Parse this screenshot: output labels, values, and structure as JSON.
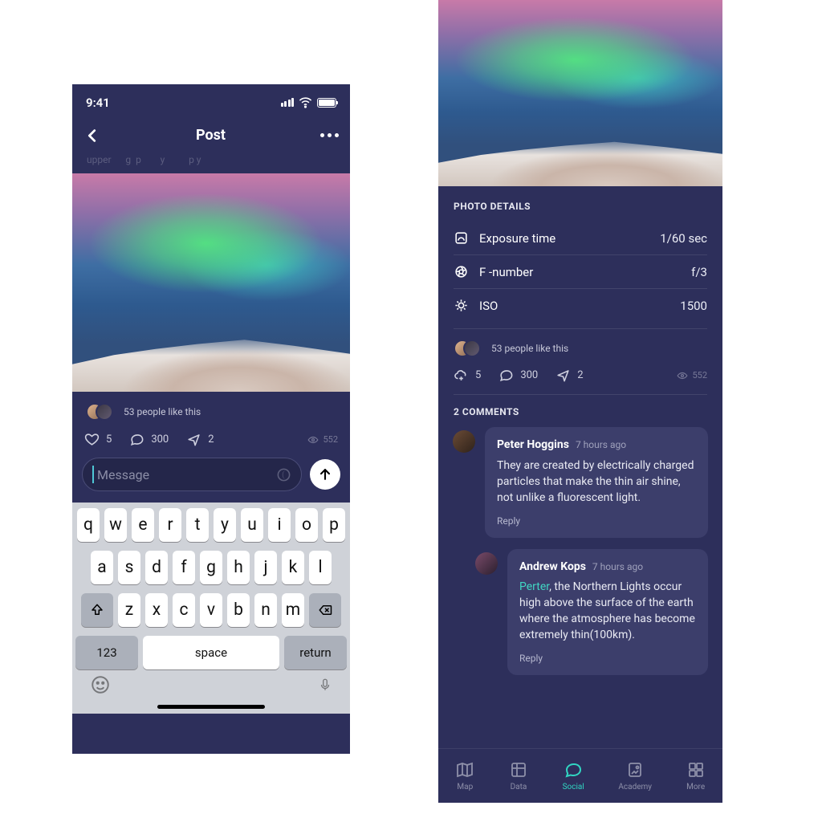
{
  "status": {
    "time": "9:41"
  },
  "header": {
    "title": "Post"
  },
  "likes": {
    "text": "53 people like this"
  },
  "counters": {
    "likes": "5",
    "comments": "300",
    "shares": "2",
    "views": "552"
  },
  "message": {
    "placeholder": "Message"
  },
  "keyboard": {
    "row1": [
      "q",
      "w",
      "e",
      "r",
      "t",
      "y",
      "u",
      "i",
      "o",
      "p"
    ],
    "row2": [
      "a",
      "s",
      "d",
      "f",
      "g",
      "h",
      "j",
      "k",
      "l"
    ],
    "row3": [
      "z",
      "x",
      "c",
      "v",
      "b",
      "n",
      "m"
    ],
    "num": "123",
    "space": "space",
    "return": "return"
  },
  "photo_details": {
    "title": "PHOTO DETAILS",
    "rows": [
      {
        "icon": "exposure",
        "label": "Exposure time",
        "value": "1/60 sec"
      },
      {
        "icon": "aperture",
        "label": "F -number",
        "value": "f/3"
      },
      {
        "icon": "iso",
        "label": "ISO",
        "value": "1500"
      }
    ]
  },
  "comments_header": "2 COMMENTS",
  "comments": [
    {
      "name": "Peter Hoggins",
      "time": "7 hours ago",
      "body": "They are created by electrically charged particles that make the thin air shine, not unlike a fluorescent light.",
      "reply": "Reply"
    },
    {
      "name": "Andrew Kops",
      "time": "7 hours ago",
      "mention": "Perter",
      "body": ", the Northern Lights occur high above the surface of the earth where the atmosphere has become extremely thin(100km).",
      "reply": "Reply"
    }
  ],
  "tabs": [
    {
      "id": "map",
      "label": "Map"
    },
    {
      "id": "data",
      "label": "Data"
    },
    {
      "id": "social",
      "label": "Social"
    },
    {
      "id": "academy",
      "label": "Academy"
    },
    {
      "id": "more",
      "label": "More"
    }
  ]
}
